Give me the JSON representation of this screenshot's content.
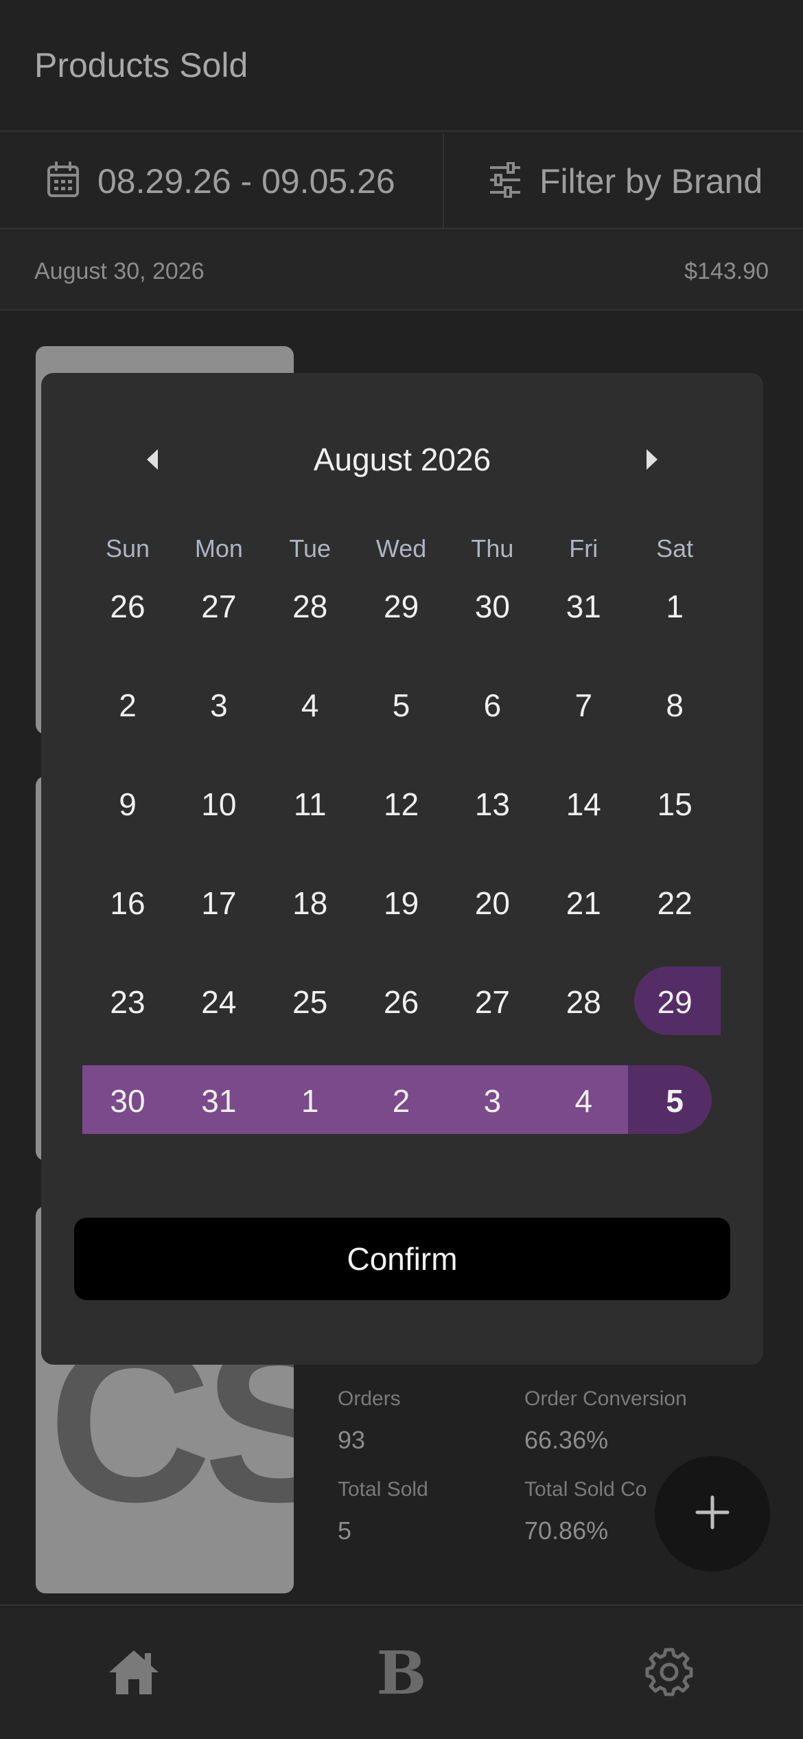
{
  "header": {
    "title": "Products Sold"
  },
  "filters": {
    "date_range": "08.29.26 - 09.05.26",
    "brand_filter": "Filter by Brand"
  },
  "summary_row": {
    "date": "August 30, 2026",
    "amount": "$143.90"
  },
  "product_card": {
    "logo_text": "CS",
    "stats": [
      {
        "label": "Orders",
        "value": "93"
      },
      {
        "label": "Order Conversion",
        "value": "66.36%"
      },
      {
        "label": "Total Sold",
        "value": "5"
      },
      {
        "label": "Total Sold Co",
        "value": "70.86%"
      }
    ]
  },
  "bottom_nav": {
    "brand_letter": "B"
  },
  "date_picker": {
    "month_label": "August 2026",
    "weekdays": [
      "Sun",
      "Mon",
      "Tue",
      "Wed",
      "Thu",
      "Fri",
      "Sat"
    ],
    "weeks": [
      [
        "26",
        "27",
        "28",
        "29",
        "30",
        "31",
        "1"
      ],
      [
        "2",
        "3",
        "4",
        "5",
        "6",
        "7",
        "8"
      ],
      [
        "9",
        "10",
        "11",
        "12",
        "13",
        "14",
        "15"
      ],
      [
        "16",
        "17",
        "18",
        "19",
        "20",
        "21",
        "22"
      ],
      [
        "23",
        "24",
        "25",
        "26",
        "27",
        "28",
        "29"
      ],
      [
        "30",
        "31",
        "1",
        "2",
        "3",
        "4",
        "5"
      ]
    ],
    "range_start": "08.29.26",
    "range_end": "09.05.26",
    "confirm_label": "Confirm"
  },
  "colors": {
    "background": "#212121",
    "modal": "#2e2e2e",
    "range_fill": "#7b4a8a",
    "range_endpoint": "#552d66",
    "confirm_button": "#000000"
  },
  "icons": [
    "calendar-icon",
    "filter-sliders-icon",
    "chevron-left-icon",
    "chevron-right-icon",
    "plus-icon",
    "home-icon",
    "brand-b-icon",
    "gear-icon"
  ]
}
